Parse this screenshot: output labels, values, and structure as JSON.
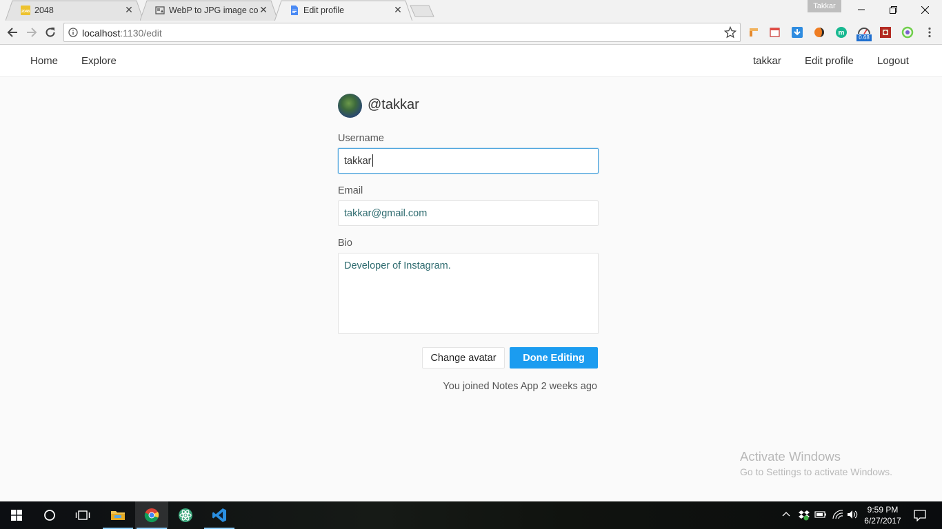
{
  "browser": {
    "tabs": [
      {
        "title": "2048",
        "favicon": "2048-favicon"
      },
      {
        "title": "WebP to JPG image conv",
        "favicon": "image-converter-favicon"
      },
      {
        "title": "Edit profile",
        "favicon": "document-favicon",
        "active": true
      }
    ],
    "profile_name": "Takkar",
    "address": {
      "host": "localhost",
      "rest": ":1130/edit"
    },
    "extensions": [
      "bookmark-ext-icon",
      "calendar-ext-icon",
      "download-ext-icon",
      "ext-circle-icon",
      "m-ext-icon",
      "speed-ext-icon",
      "puzzle-ext-icon",
      "refresh-ext-icon"
    ],
    "speed_badge": "0.68"
  },
  "appnav": {
    "home": "Home",
    "explore": "Explore",
    "user": "takkar",
    "edit_profile": "Edit profile",
    "logout": "Logout"
  },
  "profile": {
    "handle": "@takkar",
    "username_label": "Username",
    "username_value": "takkar",
    "email_label": "Email",
    "email_value": "takkar@gmail.com",
    "bio_label": "Bio",
    "bio_value": "Developer of Instagram.",
    "change_avatar": "Change avatar",
    "done_editing": "Done Editing",
    "joined": "You joined Notes App 2 weeks ago"
  },
  "watermark": {
    "title": "Activate Windows",
    "subtitle": "Go to Settings to activate Windows."
  },
  "taskbar": {
    "time": "9:59 PM",
    "date": "6/27/2017"
  },
  "colors": {
    "primary_button": "#1b9cf0",
    "focus_border": "#4ba3dd",
    "field_text": "#2e6b6f"
  }
}
